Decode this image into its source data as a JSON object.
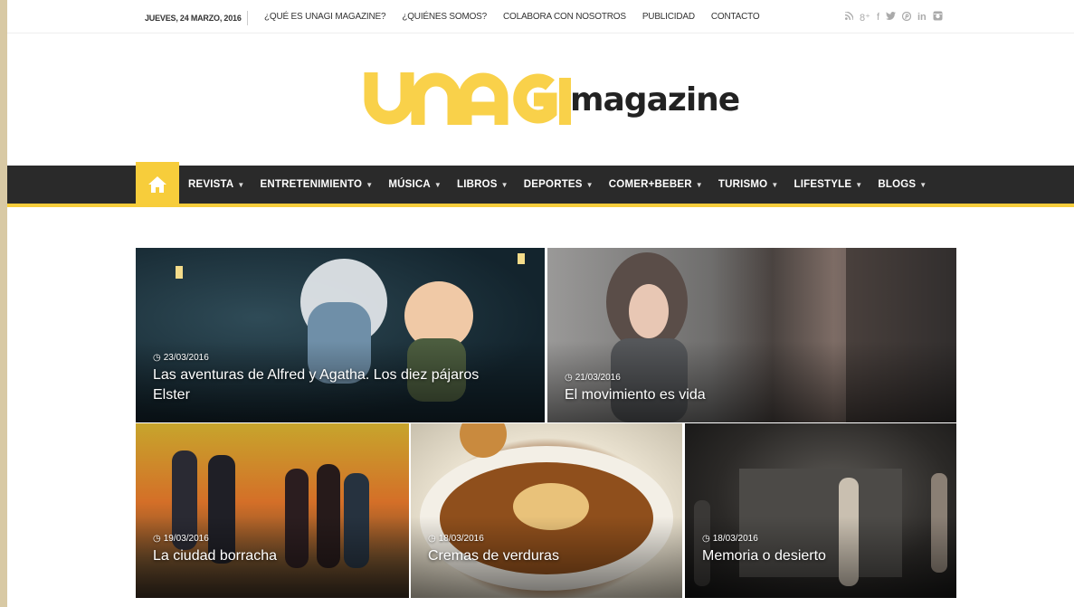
{
  "topbar": {
    "date": "JUEVES, 24 MARZO, 2016",
    "links": [
      "¿QUÉ ES UNAGI MAGAZINE?",
      "¿QUIÉNES SOMOS?",
      "COLABORA CON NOSOTROS",
      "PUBLICIDAD",
      "CONTACTO"
    ],
    "social_icons": [
      "rss-icon",
      "google-plus-icon",
      "facebook-icon",
      "twitter-icon",
      "pinterest-icon",
      "linkedin-icon",
      "instagram-icon"
    ]
  },
  "logo": {
    "brand": "UNAGI",
    "word": "magazine",
    "brand_color": "#f9d14a"
  },
  "nav": {
    "accent": "#f7cd3b",
    "items": [
      "REVISTA",
      "ENTRETENIMIENTO",
      "MÚSICA",
      "LIBROS",
      "DEPORTES",
      "COMER+BEBER",
      "TURISMO",
      "LIFESTYLE",
      "BLOGS"
    ]
  },
  "articles": [
    {
      "date": "23/03/2016",
      "title_line1": "Las aventuras de Alfred y Agatha. Los diez pájaros",
      "title_line2": "Elster"
    },
    {
      "date": "21/03/2016",
      "title_line1": "El movimiento es vida"
    },
    {
      "date": "19/03/2016",
      "title_line1": "La ciudad borracha"
    },
    {
      "date": "18/03/2016",
      "title_line1": "Cremas de verduras"
    },
    {
      "date": "18/03/2016",
      "title_line1": "Memoria o desierto"
    }
  ]
}
